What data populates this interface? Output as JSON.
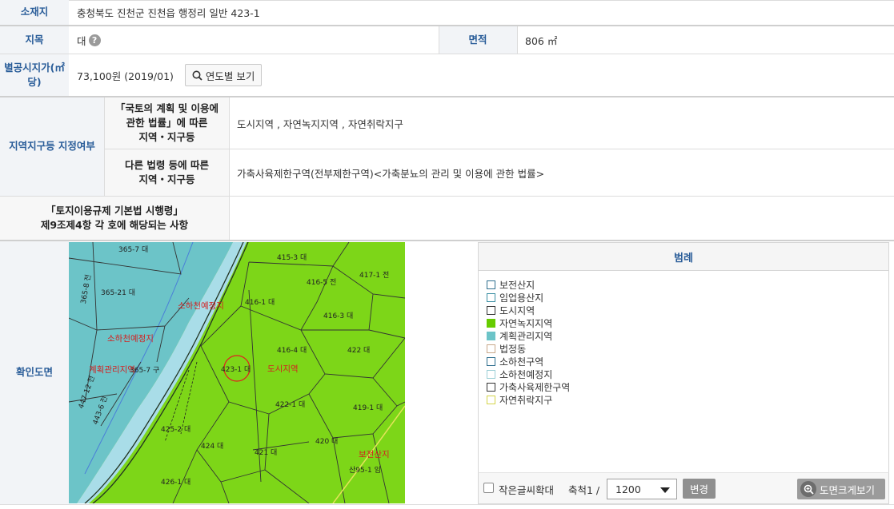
{
  "location": {
    "label": "소재지",
    "value": "충청북도 진천군 진천읍 행정리 일반 423-1"
  },
  "jimok": {
    "label": "지목",
    "value": "대",
    "help_icon": "?"
  },
  "area": {
    "label": "면적",
    "value": "806 ㎡"
  },
  "price": {
    "label_line1": "별공시지가(㎡",
    "label_line2": "당)",
    "value": "73,100원 (2019/01)",
    "button_label": "연도별 보기",
    "button_icon": "search-icon"
  },
  "zoning": {
    "label": "지역지구등 지정여부",
    "row1_label_line1": "「국토의 계획 및 이용에",
    "row1_label_line2": "관한 법률」에 따른",
    "row1_label_line3": "지역・지구등",
    "row1_value": "도시지역 , 자연녹지지역 , 자연취락지구",
    "row2_label_line1": "다른 법령 등에 따른",
    "row2_label_line2": "지역・지구등",
    "row2_value": "가축사육제한구역(전부제한구역)<가축분뇨의 관리 및 이용에 관한 법률>"
  },
  "enforcement": {
    "label_line1": "「토지이용규제 기본법 시행령」",
    "label_line2": "제9조제4항 각 호에 해당되는 사항",
    "value": ""
  },
  "map_section": {
    "label": "확인도면",
    "parcels": [
      "365-7 대",
      "365-21 대",
      "365-8 전",
      "415-3 대",
      "416-5 전",
      "417-1 전",
      "416-1 대",
      "416-3 대",
      "416-4 대",
      "422 대",
      "423-1 대",
      "422-1 대",
      "419-1 대",
      "425-2 대",
      "424 대",
      "421 대",
      "420 대",
      "426-1 대",
      "산95-1 임",
      "447-12 전",
      "443-6 전",
      "365-7 구"
    ],
    "zone_labels": [
      "소하천예정지",
      "소하천예정지",
      "계획관리지역",
      "도시지역",
      "보전산지"
    ]
  },
  "legend": {
    "title": "범례",
    "items": [
      {
        "label": "보전산지",
        "color": "#2f6f8f",
        "fill": "#ffffff"
      },
      {
        "label": "임업용산지",
        "color": "#3b8fa3",
        "fill": "#ffffff"
      },
      {
        "label": "도시지역",
        "color": "#333333",
        "fill": "#ffffff"
      },
      {
        "label": "자연녹지지역",
        "color": "#66cc00",
        "fill": "#66cc00"
      },
      {
        "label": "계획관리지역",
        "color": "#6cc4c8",
        "fill": "#6cc4c8"
      },
      {
        "label": "법정동",
        "color": "#c8a88a",
        "fill": "#ffffff"
      },
      {
        "label": "소하천구역",
        "color": "#2f6f8f",
        "fill": "#ffffff"
      },
      {
        "label": "소하천예정지",
        "color": "#9ccfd6",
        "fill": "#ffffff"
      },
      {
        "label": "가축사육제한구역",
        "color": "#333333",
        "fill": "#ffffff"
      },
      {
        "label": "자연취락지구",
        "color": "#d4d44a",
        "fill": "#ffffff"
      }
    ]
  },
  "map_tools": {
    "small_text_label": "작은글씨확대",
    "scale_label": "축척1 /",
    "scale_value": "1200",
    "change_button": "변경",
    "enlarge_button": "도면크게보기"
  }
}
